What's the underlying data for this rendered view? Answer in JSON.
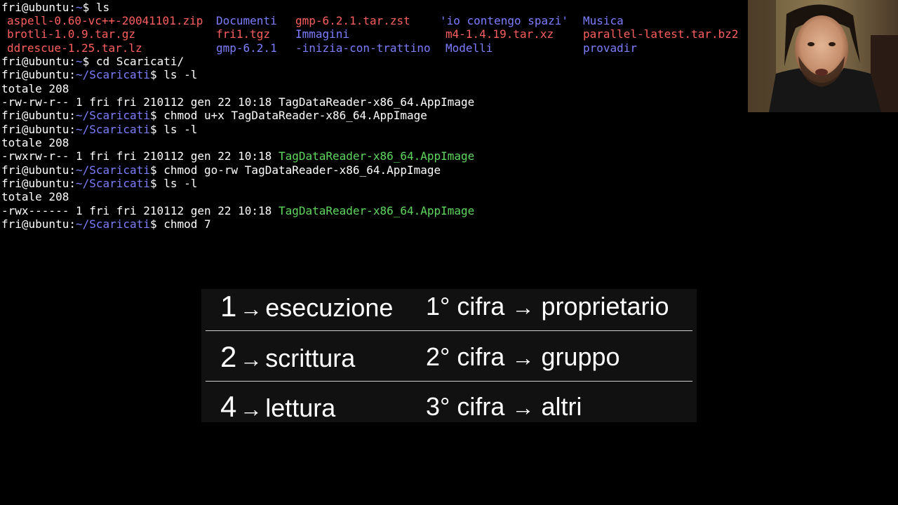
{
  "prompt": {
    "user": "fri@ubuntu",
    "home_path": "~",
    "dir_path": "~/Scaricati",
    "colon": ":",
    "dollar": "$ "
  },
  "ls_items": {
    "col1": [
      "aspell-0.60-vc++-20041101.zip",
      "brotli-1.0.9.tar.gz",
      "ddrescue-1.25.tar.lz"
    ],
    "col2": [
      "Documenti",
      "fri1.tgz",
      "gmp-6.2.1"
    ],
    "col3": [
      "gmp-6.2.1.tar.zst",
      "Immagini",
      "-inizia-con-trattino"
    ],
    "col4": [
      "'io contengo spazi'",
      "m4-1.4.19.tar.xz",
      "Modelli"
    ],
    "col5": [
      "Musica",
      "parallel-latest.tar.bz2",
      "provadir"
    ]
  },
  "commands": {
    "ls": "ls",
    "cd": "cd Scaricati/",
    "ls_l": "ls -l",
    "chmod_ux": "chmod u+x TagDataReader-x86_64.AppImage",
    "chmod_gorw": "chmod go-rw TagDataReader-x86_64.AppImage",
    "chmod_partial": "chmod 7"
  },
  "outputs": {
    "totale": "totale 208",
    "entry1_meta": "-rw-rw-r-- 1 fri fri 210112 gen 22 10:18 ",
    "entry2_meta": "-rwxrw-r-- 1 fri fri 210112 gen 22 10:18 ",
    "entry3_meta": "-rwx------ 1 fri fri 210112 gen 22 10:18 ",
    "filename": "TagDataReader-x86_64.AppImage"
  },
  "overlay": {
    "arrow": "→",
    "rows": [
      {
        "num": "1",
        "perm": "esecuzione",
        "digit": "1° cifra",
        "target": "proprietario"
      },
      {
        "num": "2",
        "perm": "scrittura",
        "digit": "2° cifra",
        "target": "gruppo"
      },
      {
        "num": "4",
        "perm": "lettura",
        "digit": "3° cifra",
        "target": "altri"
      }
    ]
  },
  "colors": {
    "background": "#000000",
    "prompt_user": "#ffffff",
    "prompt_path": "#7d7dff",
    "directory": "#7d7dff",
    "archive": "#ff5f5f",
    "executable": "#5fd75f",
    "overlay_bg": "#111111"
  },
  "icons": {
    "webcam": "presenter-webcam-feed"
  }
}
